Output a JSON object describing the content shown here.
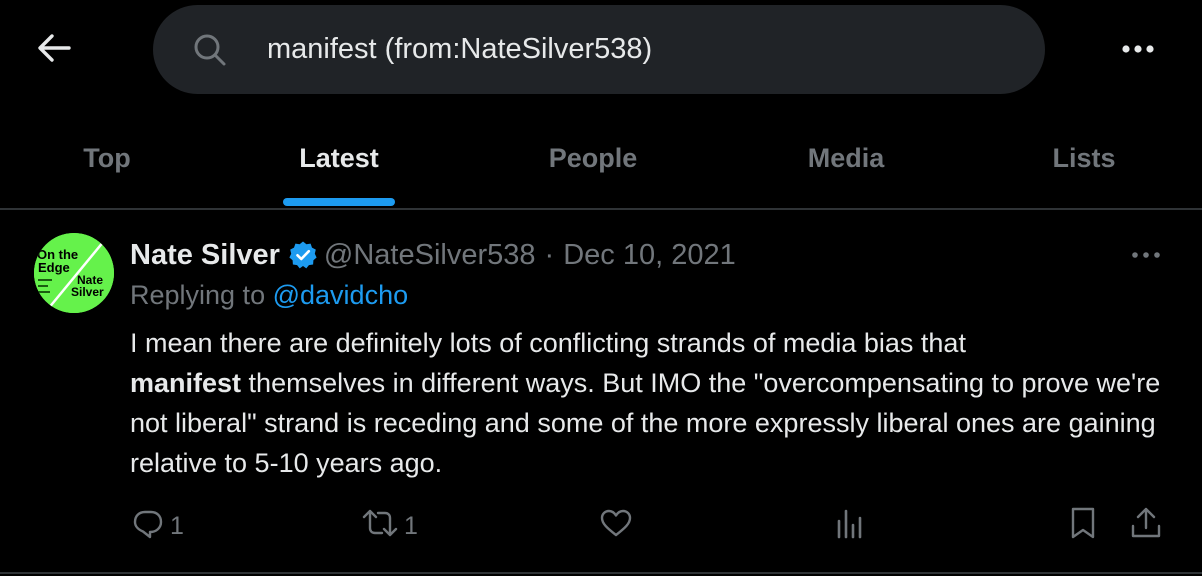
{
  "header": {
    "back_icon": "arrow-left-icon",
    "search": {
      "icon": "search-icon",
      "value": "manifest (from:NateSilver538)"
    },
    "more_icon": "more-horizontal-icon"
  },
  "tabs": [
    {
      "label": "Top",
      "active": false
    },
    {
      "label": "Latest",
      "active": true
    },
    {
      "label": "People",
      "active": false
    },
    {
      "label": "Media",
      "active": false
    },
    {
      "label": "Lists",
      "active": false
    }
  ],
  "colors": {
    "accent": "#1d9bf0",
    "background": "#000000",
    "muted": "#71767b",
    "avatar_green": "#65f24b"
  },
  "tweet": {
    "avatar": {
      "text_line1": "On the",
      "text_line2": "Edge",
      "text_line3": "Nate",
      "text_line4": "Silver"
    },
    "author_name": "Nate Silver",
    "verified_icon": "verified-badge-icon",
    "handle": "@NateSilver538",
    "separator": "·",
    "date": "Dec 10, 2021",
    "replying_prefix": "Replying to",
    "replying_to": "@davidcho",
    "body_start": "I mean there are definitely lots of conflicting strands of media bias that",
    "body_bold": "manifest",
    "body_end": " themselves in different ways. But IMO the \"overcompensating to prove we're not liberal\" strand is receding and some of the more expressly liberal ones are gaining relative to 5-10 years ago.",
    "actions": {
      "reply_count": "1",
      "retweet_count": "1"
    }
  }
}
